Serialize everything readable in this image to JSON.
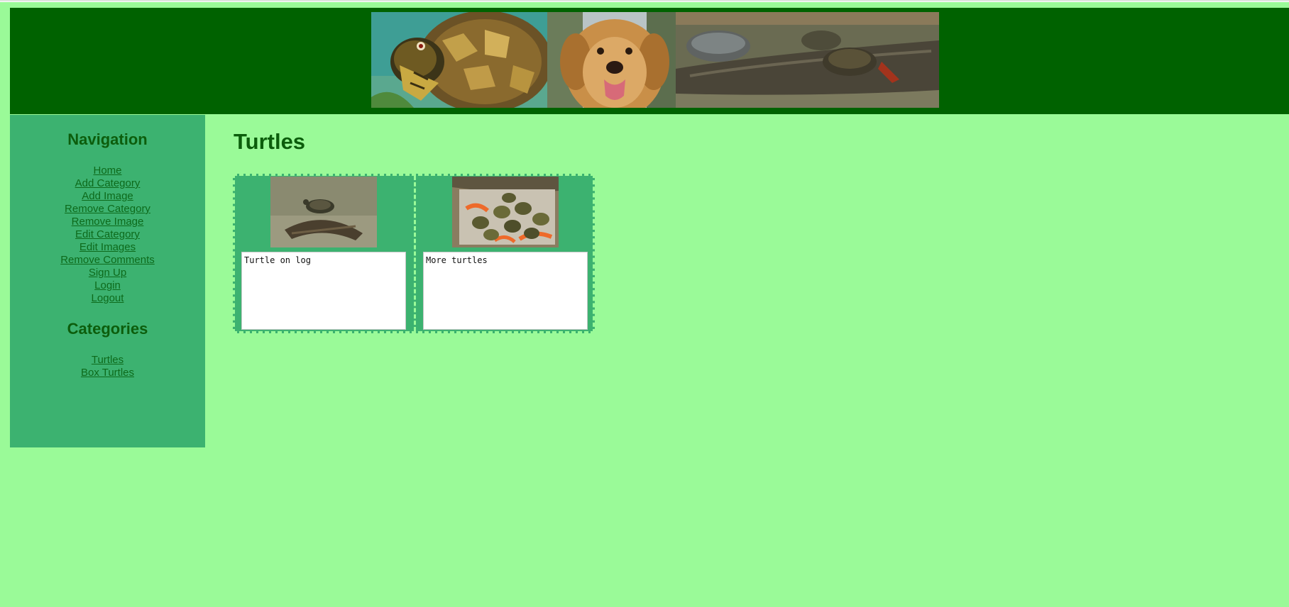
{
  "colors": {
    "page_bg": "#9afa98",
    "header_bg": "#006200",
    "sidebar_bg": "#3cb270",
    "heading_text": "#0b5d0b",
    "link_text": "#0d6a1b"
  },
  "header": {
    "banner_images": [
      "box-turtle-photo",
      "golden-retriever-photo",
      "turtles-on-log-photo"
    ]
  },
  "sidebar": {
    "navigation_title": "Navigation",
    "nav_links": [
      {
        "label": "Home"
      },
      {
        "label": "Add Category"
      },
      {
        "label": "Add Image"
      },
      {
        "label": "Remove Category"
      },
      {
        "label": "Remove Image"
      },
      {
        "label": "Edit Category"
      },
      {
        "label": "Edit Images"
      },
      {
        "label": "Remove Comments"
      },
      {
        "label": "Sign Up"
      },
      {
        "label": "Login"
      },
      {
        "label": "Logout"
      }
    ],
    "categories_title": "Categories",
    "category_links": [
      {
        "label": "Turtles"
      },
      {
        "label": "Box Turtles"
      }
    ]
  },
  "main": {
    "title": "Turtles",
    "gallery": [
      {
        "image": "turtle-on-log-thumbnail",
        "caption": "Turtle on log"
      },
      {
        "image": "baby-turtles-thumbnail",
        "caption": "More turtles"
      }
    ]
  }
}
